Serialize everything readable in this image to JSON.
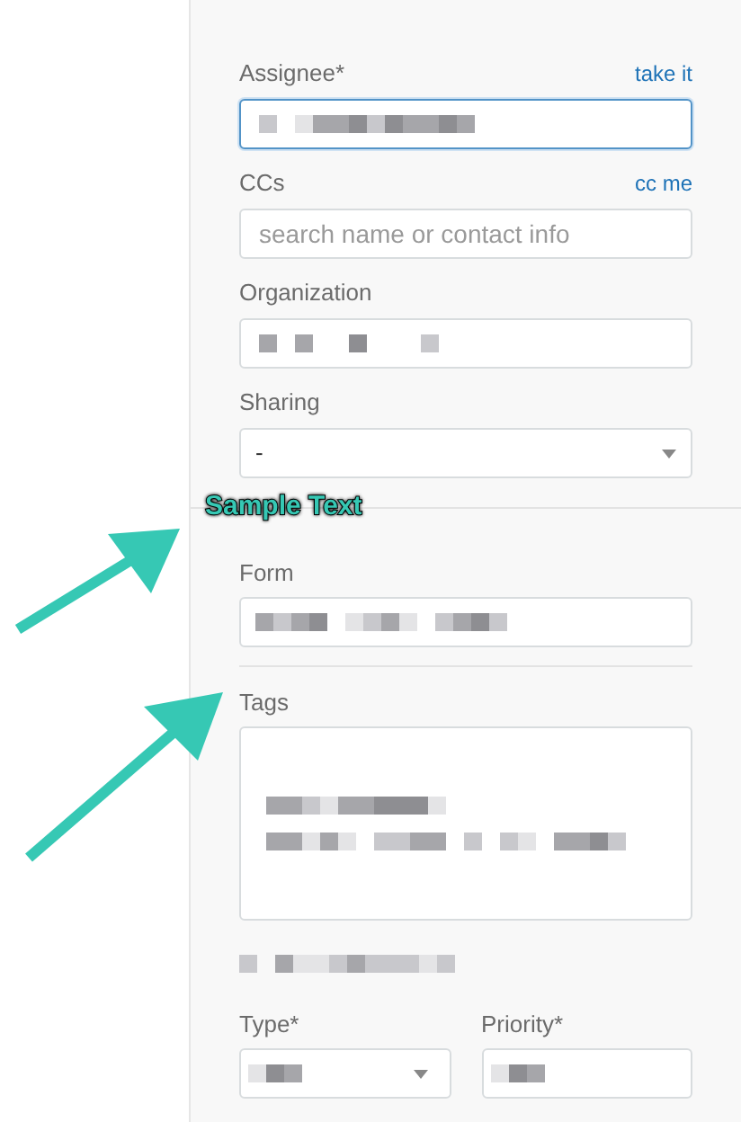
{
  "fields": [
    {
      "label": "Assignee*",
      "link": "take it",
      "kind": "input",
      "focused": true
    },
    {
      "label": "CCs",
      "link": "cc me",
      "kind": "input",
      "placeholder": "search name or contact info",
      "focused": false
    },
    {
      "label": "Organization",
      "kind": "input",
      "focused": false
    },
    {
      "label": "Sharing",
      "kind": "select",
      "value": "-"
    }
  ],
  "annotation": {
    "text": "Sample Text"
  },
  "form_field": {
    "label": "Form"
  },
  "tags": {
    "label": "Tags"
  },
  "type": {
    "label": "Type*"
  },
  "priority": {
    "label": "Priority*"
  }
}
